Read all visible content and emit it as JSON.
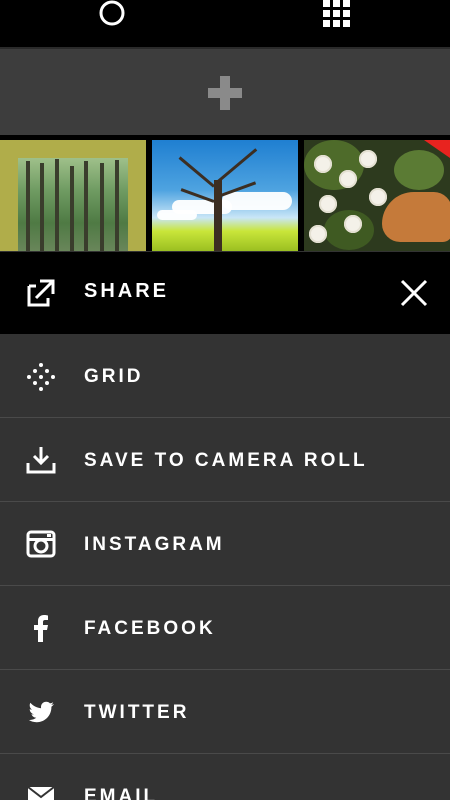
{
  "share": {
    "title": "SHARE"
  },
  "menu": {
    "items": [
      {
        "label": "GRID",
        "icon": "grid-dots-icon"
      },
      {
        "label": "SAVE TO CAMERA ROLL",
        "icon": "download-icon"
      },
      {
        "label": "INSTAGRAM",
        "icon": "instagram-icon"
      },
      {
        "label": "FACEBOOK",
        "icon": "facebook-icon"
      },
      {
        "label": "TWITTER",
        "icon": "twitter-icon"
      },
      {
        "label": "EMAIL",
        "icon": "email-icon"
      }
    ]
  },
  "colors": {
    "background": "#333333",
    "bar": "#000000",
    "text": "#ffffff",
    "selected_corner": "#e8231f"
  }
}
